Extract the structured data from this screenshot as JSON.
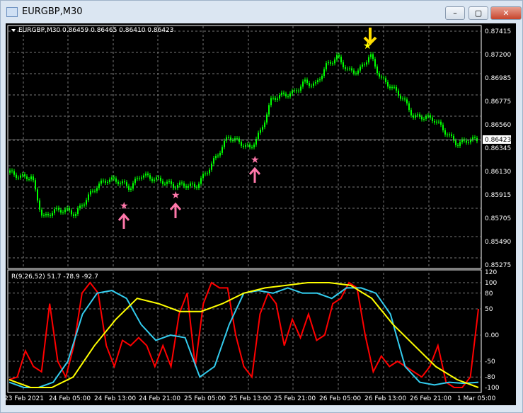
{
  "window": {
    "title": "EURGBP,M30",
    "minimize": "–",
    "maximize": "▢",
    "close": "✕"
  },
  "main_chart": {
    "info": "EURGBP,M30  0.86459 0.86465 0.86410 0.86423",
    "current_price": "0.86423",
    "price_ticks": [
      "0.87415",
      "0.87200",
      "0.86985",
      "0.86775",
      "0.86560",
      "0.86345",
      "0.86130",
      "0.85915",
      "0.85705",
      "0.85490",
      "0.85275"
    ],
    "candle_color": "#00ff00"
  },
  "indicator": {
    "label": "R(9,26,52) 51.7 -78.9 -92.7",
    "ticks": [
      "120",
      "100",
      "80",
      "50",
      "0.00",
      "-50",
      "-80",
      "-100"
    ]
  },
  "time_labels": [
    "23 Feb 2021",
    "24 Feb 05:00",
    "24 Feb 13:00",
    "24 Feb 21:00",
    "25 Feb 05:00",
    "25 Feb 13:00",
    "25 Feb 21:00",
    "26 Feb 05:00",
    "26 Feb 13:00",
    "26 Feb 21:00",
    "1 Mar 05:00"
  ],
  "chart_data": {
    "type": "line",
    "price_closes": [
      0.8612,
      0.8608,
      0.8608,
      0.857,
      0.8577,
      0.8578,
      0.8574,
      0.8588,
      0.86,
      0.8606,
      0.8604,
      0.8598,
      0.861,
      0.8607,
      0.8604,
      0.86,
      0.8601,
      0.8599,
      0.8612,
      0.8628,
      0.8645,
      0.864,
      0.8634,
      0.865,
      0.868,
      0.8683,
      0.8685,
      0.8695,
      0.8692,
      0.871,
      0.8718,
      0.8705,
      0.8705,
      0.872,
      0.8698,
      0.869,
      0.868,
      0.8663,
      0.8663,
      0.866,
      0.8648,
      0.8638,
      0.8642,
      0.8642
    ],
    "series": [
      {
        "name": "fast",
        "color": "#ff0000",
        "values": [
          -85,
          -80,
          -30,
          -60,
          -70,
          60,
          -50,
          -80,
          -20,
          80,
          100,
          80,
          -20,
          -60,
          -10,
          -20,
          -5,
          -20,
          -60,
          -20,
          -60,
          40,
          80,
          -60,
          60,
          100,
          90,
          90,
          0,
          -60,
          -80,
          40,
          80,
          60,
          -20,
          30,
          -5,
          40,
          -10,
          0,
          60,
          70,
          100,
          90,
          0,
          -70,
          -40,
          -60,
          -50,
          -60,
          -70,
          -80,
          -60,
          -20,
          -90,
          -100,
          -100,
          -80,
          50
        ]
      },
      {
        "name": "mid",
        "color": "#33ccee",
        "values": [
          -90,
          -100,
          -100,
          -90,
          -50,
          40,
          80,
          85,
          70,
          20,
          -10,
          0,
          -5,
          -80,
          -60,
          20,
          80,
          85,
          80,
          90,
          80,
          80,
          70,
          90,
          90,
          80,
          40,
          -60,
          -90,
          -95,
          -90,
          -92,
          -90
        ]
      },
      {
        "name": "slow",
        "color": "#ffff00",
        "values": [
          -85,
          -100,
          -100,
          -80,
          -20,
          30,
          70,
          60,
          45,
          45,
          60,
          80,
          90,
          95,
          100,
          100,
          95,
          70,
          20,
          -20,
          -60,
          -85,
          -100
        ]
      }
    ],
    "ylim": [
      -120,
      120
    ]
  }
}
